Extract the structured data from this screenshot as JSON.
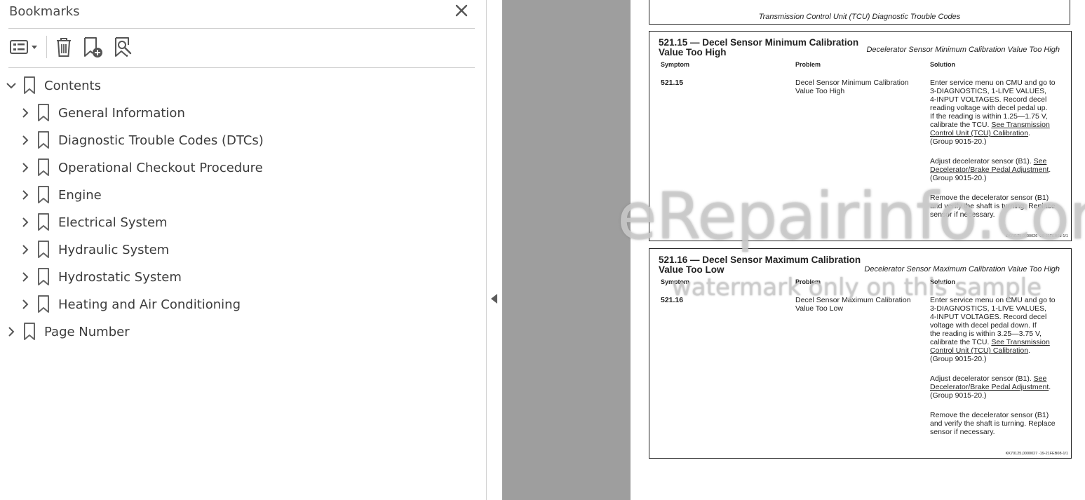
{
  "panel": {
    "title": "Bookmarks",
    "bookmarks": [
      {
        "label": "Contents",
        "expanded": true
      },
      {
        "label": "General Information"
      },
      {
        "label": "Diagnostic Trouble Codes (DTCs)"
      },
      {
        "label": "Operational Checkout Procedure"
      },
      {
        "label": "Engine"
      },
      {
        "label": "Electrical System"
      },
      {
        "label": "Hydraulic System"
      },
      {
        "label": "Hydrostatic System"
      },
      {
        "label": "Heating and Air Conditioning"
      },
      {
        "label": "Page Number"
      }
    ]
  },
  "document": {
    "top_caption": "Transmission Control Unit (TCU) Diagnostic Trouble Codes",
    "columns": {
      "symptom": "Symptom",
      "problem": "Problem",
      "solution": "Solution"
    },
    "sections": [
      {
        "title_line1": "521.15 — Decel Sensor Minimum Calibration",
        "title_line2": "Value Too High",
        "subtitle": "Decelerator Sensor Minimum Calibration Value Too High",
        "code": "521.15",
        "problem_line1": "Decel Sensor Minimum Calibration",
        "problem_line2": "Value Too High",
        "sol1": [
          "Enter service menu on CMU and go to",
          "3-DIAGNOSTICS, 1-LIVE VALUES,",
          "4-INPUT VOLTAGES. Record decel",
          "reading voltage with decel pedal up.",
          "If the reading is within 1.25—1.75 V,"
        ],
        "sol1_pre": "calibrate the TCU. ",
        "sol1_link1": "See Transmission",
        "sol1_link2": "Control Unit (TCU) Calibration",
        "sol1_end": "(Group 9015-20.)",
        "sol2_pre": "Adjust decelerator sensor (B1). ",
        "sol2_link1": "See",
        "sol2_link2": "Decelerator/Brake Pedal Adjustment",
        "sol2_end": "(Group 9015-20.)",
        "sol3": [
          "Remove the decelerator sensor (B1)",
          "and verify the shaft is turning. Replace",
          "sensor if necessary."
        ],
        "ref": "KK70125,0000026 -19-21FEB08-1/1"
      },
      {
        "title_line1": "521.16 — Decel Sensor Maximum Calibration",
        "title_line2": "Value Too Low",
        "subtitle": "Decelerator Sensor Maximum Calibration Value Too High",
        "code": "521.16",
        "problem_line1": "Decel Sensor Maximum Calibration",
        "problem_line2": "Value Too Low",
        "sol1": [
          "Enter service menu on CMU and go to",
          "3-DIAGNOSTICS, 1-LIVE VALUES,",
          "4-INPUT VOLTAGES. Record decel",
          "voltage with decel pedal down.  If",
          "the reading is within 3.25—3.75 V,"
        ],
        "sol1_pre": "calibrate the TCU. ",
        "sol1_link1": "See Transmission",
        "sol1_link2": "Control Unit (TCU) Calibration",
        "sol1_end": "(Group 9015-20.)",
        "sol2_pre": "Adjust decelerator sensor (B1). ",
        "sol2_link1": "See",
        "sol2_link2": "Decelerator/Brake Pedal Adjustment",
        "sol2_end": "(Group 9015-20.)",
        "sol3": [
          "Remove the decelerator sensor (B1)",
          "and verify the shaft is turning. Replace",
          "sensor if necessary."
        ],
        "ref": "KK70125,0000027 -19-21FEB08-1/1"
      }
    ]
  },
  "watermark": {
    "line1": "eRepairinfo.com",
    "line2": "watermark only on this sample"
  }
}
